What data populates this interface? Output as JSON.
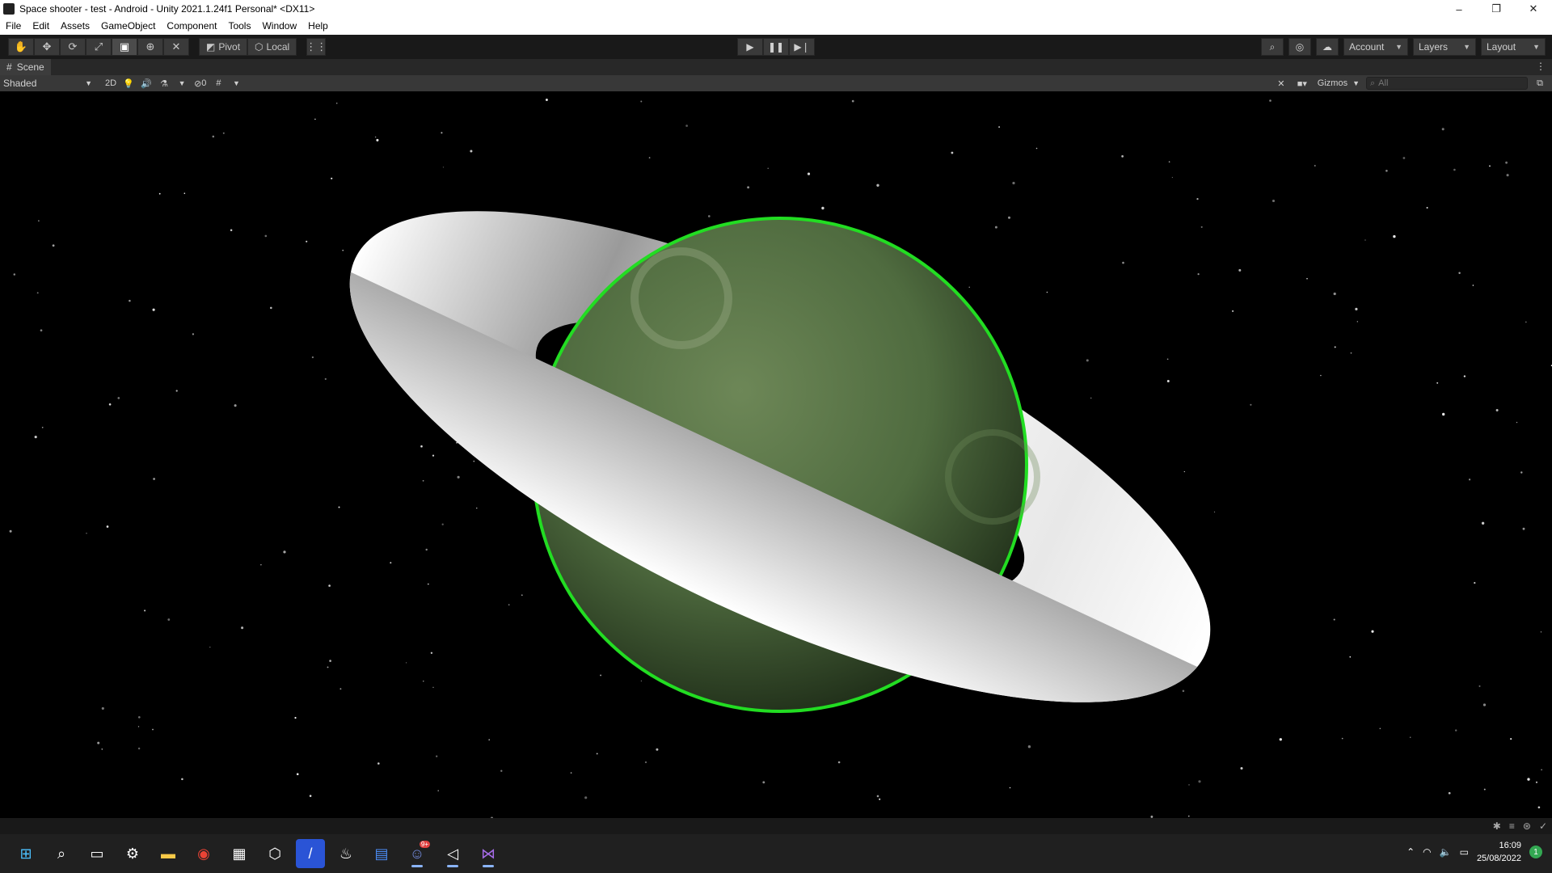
{
  "window": {
    "title": "Space shooter - test - Android - Unity 2021.1.24f1 Personal* <DX11>",
    "controls": {
      "minimize": "–",
      "restore": "❐",
      "close": "✕"
    }
  },
  "menu": [
    "File",
    "Edit",
    "Assets",
    "GameObject",
    "Component",
    "Tools",
    "Window",
    "Help"
  ],
  "toolbar": {
    "tools": [
      "hand-tool-icon",
      "move-tool-icon",
      "rotate-tool-icon",
      "scale-tool-icon",
      "rect-tool-icon",
      "transform-tool-icon",
      "custom-tool-icon"
    ],
    "pivot_label": "Pivot",
    "local_label": "Local",
    "account_label": "Account",
    "layers_label": "Layers",
    "layout_label": "Layout"
  },
  "scene_tab": {
    "label": "Scene"
  },
  "scene_toolbar": {
    "shading_mode": "Shaded",
    "mode_2d": "2D",
    "hidden_count": "0",
    "gizmos_label": "Gizmos",
    "search_placeholder": "All"
  },
  "taskbar": {
    "time": "16:09",
    "date": "25/08/2022",
    "notification_count": "1",
    "discord_badge": "9+"
  },
  "colors": {
    "planet_base": "#4f6b3f",
    "planet_rim": "#22dd22",
    "ring": "#ffffff",
    "editor_bg": "#191919"
  }
}
